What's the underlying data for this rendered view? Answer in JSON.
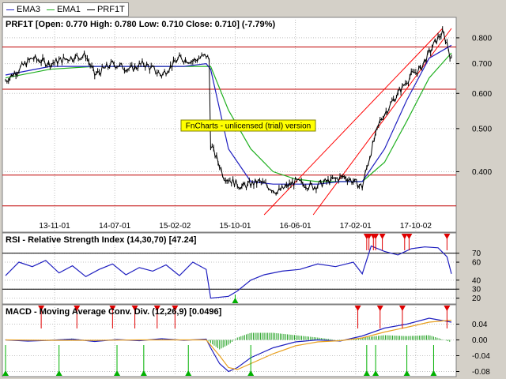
{
  "legend": [
    {
      "name": "EMA3",
      "color": "#2020c0"
    },
    {
      "name": "EMA1",
      "color": "#20b020"
    },
    {
      "name": "PRF1T",
      "color": "#000000"
    }
  ],
  "watermark": "FnCharts - unlicensed (trial) version",
  "chart_data": [
    {
      "type": "line",
      "title": "PRF1T [Open: 0.770  High: 0.780  Low: 0.710  Close: 0.710] (-7.79%)",
      "x_tick_labels": [
        "13-11-01",
        "14-07-01",
        "15-02-02",
        "15-10-01",
        "16-06-01",
        "17-02-01",
        "17-10-02"
      ],
      "y_ticks": [
        0.4,
        0.5,
        0.6,
        0.7,
        0.8
      ],
      "y_tick_labels": [
        "0.400",
        "0.500",
        "0.600",
        "0.700",
        "0.800"
      ],
      "ylim": [
        0.32,
        0.84
      ],
      "log_scale": true,
      "horizontal_lines": [
        0.763,
        0.613,
        0.393,
        0.335
      ],
      "trend_lines": [
        {
          "from": [
            0.58,
            0.32
          ],
          "to": [
            0.98,
            0.84
          ]
        },
        {
          "from": [
            0.69,
            0.32
          ],
          "to": [
            1.0,
            0.84
          ]
        }
      ],
      "series": [
        {
          "name": "PRF1T",
          "color": "#000000",
          "x": [
            0,
            0.03,
            0.06,
            0.1,
            0.14,
            0.18,
            0.2,
            0.24,
            0.28,
            0.31,
            0.35,
            0.39,
            0.42,
            0.45,
            0.458,
            0.46,
            0.49,
            0.53,
            0.57,
            0.61,
            0.65,
            0.69,
            0.72,
            0.76,
            0.8,
            0.84,
            0.88,
            0.91,
            0.93,
            0.95,
            0.97,
            0.98,
            0.985,
            0.99,
            1.0
          ],
          "values": [
            0.64,
            0.68,
            0.72,
            0.7,
            0.72,
            0.73,
            0.66,
            0.7,
            0.68,
            0.7,
            0.66,
            0.72,
            0.71,
            0.73,
            0.71,
            0.46,
            0.39,
            0.37,
            0.38,
            0.36,
            0.38,
            0.37,
            0.38,
            0.39,
            0.37,
            0.52,
            0.6,
            0.66,
            0.68,
            0.74,
            0.8,
            0.82,
            0.8,
            0.78,
            0.71
          ]
        },
        {
          "name": "EMA3",
          "color": "#2020c0",
          "x": [
            0,
            0.1,
            0.2,
            0.3,
            0.4,
            0.45,
            0.46,
            0.5,
            0.55,
            0.6,
            0.7,
            0.75,
            0.8,
            0.85,
            0.9,
            0.95,
            1.0
          ],
          "values": [
            0.66,
            0.69,
            0.69,
            0.69,
            0.69,
            0.7,
            0.68,
            0.45,
            0.38,
            0.375,
            0.375,
            0.38,
            0.38,
            0.45,
            0.58,
            0.72,
            0.77
          ]
        },
        {
          "name": "EMA1",
          "color": "#20b020",
          "x": [
            0,
            0.1,
            0.2,
            0.3,
            0.4,
            0.45,
            0.46,
            0.5,
            0.55,
            0.6,
            0.65,
            0.7,
            0.75,
            0.8,
            0.85,
            0.9,
            0.95,
            1.0
          ],
          "values": [
            0.65,
            0.68,
            0.69,
            0.69,
            0.69,
            0.69,
            0.69,
            0.55,
            0.45,
            0.4,
            0.385,
            0.38,
            0.38,
            0.38,
            0.42,
            0.52,
            0.65,
            0.74
          ]
        }
      ]
    },
    {
      "type": "line",
      "title": "RSI - Relative Strength Index (14,30,70) [47.24]",
      "y_ticks": [
        20,
        30,
        40,
        60,
        70
      ],
      "y_tick_labels": [
        "20",
        "30",
        "40",
        "60",
        "70"
      ],
      "ylim": [
        17,
        82
      ],
      "horizontal_lines": [
        70,
        30
      ],
      "series": [
        {
          "name": "RSI",
          "color": "#2020c0",
          "x": [
            0,
            0.03,
            0.06,
            0.09,
            0.12,
            0.15,
            0.18,
            0.21,
            0.24,
            0.27,
            0.3,
            0.33,
            0.36,
            0.39,
            0.42,
            0.45,
            0.46,
            0.5,
            0.52,
            0.55,
            0.58,
            0.62,
            0.66,
            0.7,
            0.74,
            0.78,
            0.8,
            0.82,
            0.85,
            0.88,
            0.91,
            0.94,
            0.97,
            0.99,
            1.0
          ],
          "values": [
            45,
            60,
            55,
            62,
            48,
            56,
            44,
            52,
            58,
            46,
            54,
            50,
            57,
            45,
            60,
            52,
            20,
            22,
            28,
            40,
            46,
            50,
            52,
            58,
            55,
            60,
            47,
            78,
            72,
            68,
            75,
            77,
            76,
            66,
            47
          ]
        }
      ],
      "signal_markers": [
        {
          "x": 0.81,
          "kind": "sell"
        },
        {
          "x": 0.815,
          "kind": "sell"
        },
        {
          "x": 0.825,
          "kind": "sell"
        },
        {
          "x": 0.83,
          "kind": "sell"
        },
        {
          "x": 0.845,
          "kind": "sell"
        },
        {
          "x": 0.895,
          "kind": "sell"
        },
        {
          "x": 0.905,
          "kind": "sell"
        },
        {
          "x": 0.99,
          "kind": "sell"
        },
        {
          "x": 0.515,
          "kind": "buy"
        }
      ]
    },
    {
      "type": "line",
      "title": "MACD - Moving Average Conv. Div. (12,26,9) [0.0496]",
      "y_ticks": [
        0.04,
        0.0,
        -0.04,
        -0.08
      ],
      "y_tick_labels": [
        "0.04",
        "0.00",
        "-0.04",
        "-0.08"
      ],
      "ylim": [
        -0.085,
        0.065
      ],
      "series": [
        {
          "name": "MACD",
          "color": "#2020c0",
          "x": [
            0,
            0.05,
            0.1,
            0.15,
            0.2,
            0.25,
            0.3,
            0.35,
            0.4,
            0.45,
            0.46,
            0.48,
            0.5,
            0.52,
            0.55,
            0.6,
            0.65,
            0.7,
            0.75,
            0.8,
            0.85,
            0.9,
            0.95,
            1.0
          ],
          "values": [
            0.0,
            -0.003,
            -0.001,
            0.002,
            -0.004,
            0.001,
            -0.002,
            0.003,
            -0.001,
            0.002,
            -0.02,
            -0.06,
            -0.08,
            -0.07,
            -0.045,
            -0.02,
            -0.005,
            0.0,
            -0.003,
            0.01,
            0.03,
            0.04,
            0.055,
            0.045
          ]
        },
        {
          "name": "Signal",
          "color": "#e8a020",
          "x": [
            0,
            0.1,
            0.2,
            0.3,
            0.4,
            0.45,
            0.48,
            0.5,
            0.52,
            0.55,
            0.6,
            0.65,
            0.7,
            0.75,
            0.8,
            0.85,
            0.9,
            0.95,
            1.0
          ],
          "values": [
            0.0,
            -0.001,
            -0.001,
            0.0,
            0.0,
            0.0,
            -0.04,
            -0.07,
            -0.075,
            -0.06,
            -0.035,
            -0.015,
            -0.005,
            -0.002,
            0.005,
            0.02,
            0.032,
            0.045,
            0.05
          ]
        }
      ],
      "signal_markers": [
        {
          "x": 0.08,
          "kind": "sell"
        },
        {
          "x": 0.16,
          "kind": "sell"
        },
        {
          "x": 0.24,
          "kind": "sell"
        },
        {
          "x": 0.29,
          "kind": "sell"
        },
        {
          "x": 0.34,
          "kind": "sell"
        },
        {
          "x": 0.38,
          "kind": "sell"
        },
        {
          "x": 0.79,
          "kind": "sell"
        },
        {
          "x": 0.84,
          "kind": "sell"
        },
        {
          "x": 0.89,
          "kind": "sell"
        },
        {
          "x": 0.99,
          "kind": "sell"
        },
        {
          "x": 0.0,
          "kind": "buy"
        },
        {
          "x": 0.12,
          "kind": "buy"
        },
        {
          "x": 0.25,
          "kind": "buy"
        },
        {
          "x": 0.31,
          "kind": "buy"
        },
        {
          "x": 0.41,
          "kind": "buy"
        },
        {
          "x": 0.55,
          "kind": "buy"
        },
        {
          "x": 0.81,
          "kind": "buy"
        },
        {
          "x": 0.83,
          "kind": "buy"
        },
        {
          "x": 0.9,
          "kind": "buy"
        },
        {
          "x": 0.96,
          "kind": "buy"
        }
      ]
    }
  ]
}
